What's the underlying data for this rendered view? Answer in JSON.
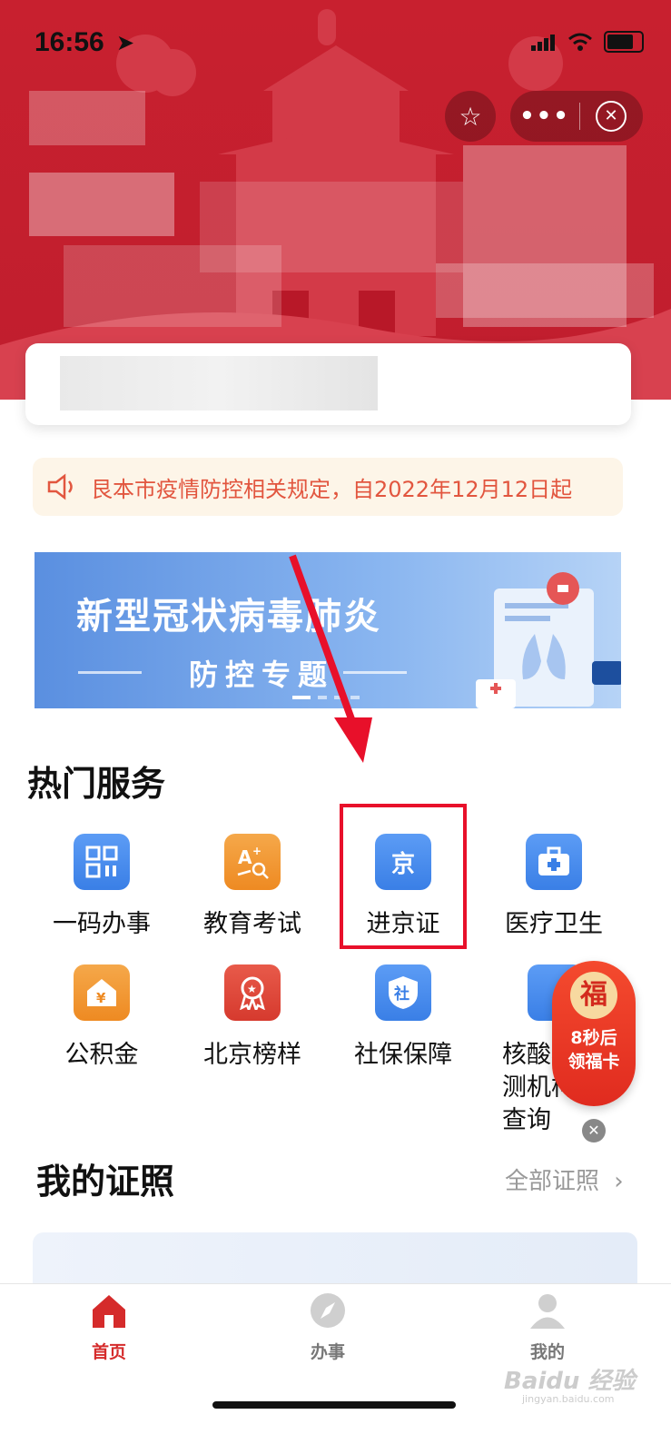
{
  "status_bar": {
    "time": "16:56"
  },
  "mini_program": {
    "more_label": "•••",
    "close_label": "✕"
  },
  "notice": {
    "text": "艮本市疫情防控相关规定，自2022年12月12日起"
  },
  "banner": {
    "title": "新型冠状病毒肺炎",
    "subtitle": "防控专题"
  },
  "hot_services": {
    "title": "热门服务",
    "items": [
      {
        "label": "一码办事",
        "icon": "qr-code-icon",
        "color": "blue"
      },
      {
        "label": "教育考试",
        "icon": "exam-icon",
        "color": "orange"
      },
      {
        "label": "进京证",
        "icon": "jing-icon",
        "glyph": "京",
        "color": "blue"
      },
      {
        "label": "医疗卫生",
        "icon": "medical-kit-icon",
        "color": "blue"
      },
      {
        "label": "公积金",
        "icon": "housing-fund-icon",
        "glyph": "¥",
        "color": "orange"
      },
      {
        "label": "北京榜样",
        "icon": "medal-icon",
        "color": "red"
      },
      {
        "label": "社保保障",
        "icon": "social-security-icon",
        "glyph": "社",
        "color": "blue"
      },
      {
        "label": "核酸检测机构查询",
        "icon": "nucleic-test-icon",
        "color": "blue"
      }
    ]
  },
  "float_badge": {
    "fu": "福",
    "line1": "8秒后",
    "line2": "领福卡",
    "close": "✕"
  },
  "certificates": {
    "title": "我的证照",
    "all_label": "全部证照"
  },
  "tabbar": {
    "tabs": [
      {
        "label": "首页"
      },
      {
        "label": "办事"
      },
      {
        "label": "我的"
      }
    ]
  },
  "watermark": {
    "main": "Baidu 经验",
    "sub": "jingyan.baidu.com"
  },
  "colors": {
    "brand_red": "#c8202f",
    "accent_blue": "#3a7fe6",
    "highlight": "#e8102a"
  }
}
